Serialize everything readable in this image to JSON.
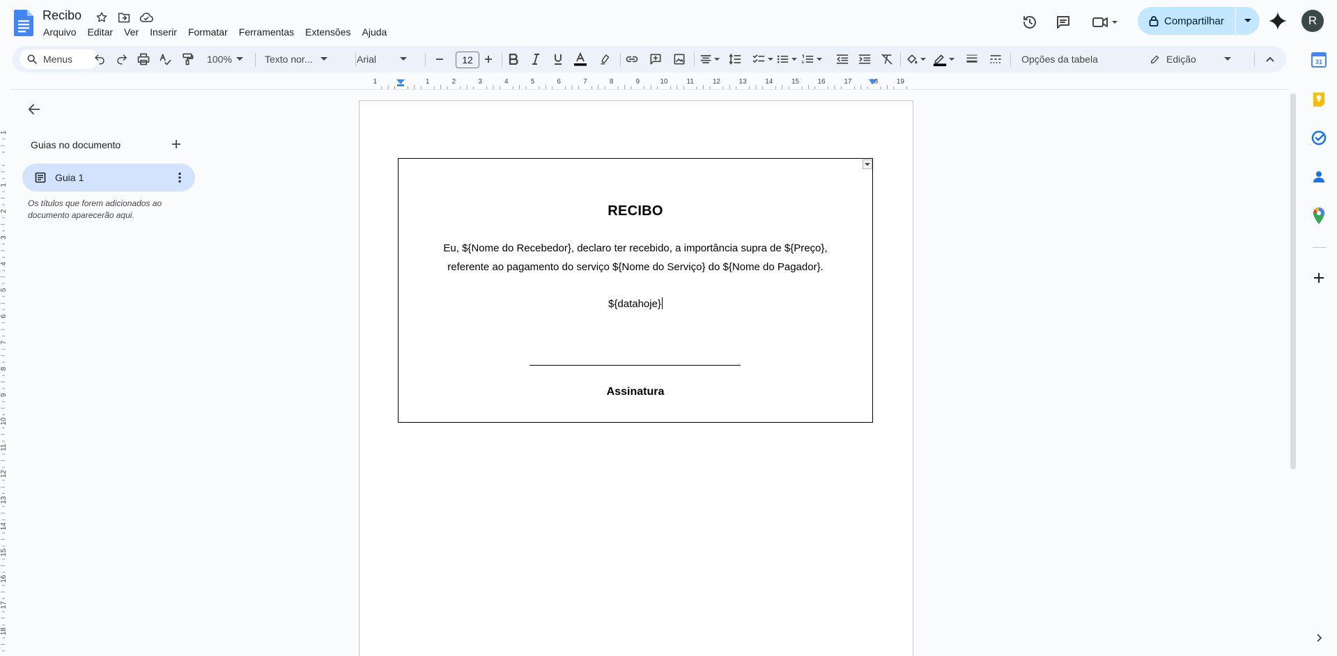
{
  "document": {
    "title": "Recibo"
  },
  "menu": [
    "Arquivo",
    "Editar",
    "Ver",
    "Inserir",
    "Formatar",
    "Ferramentas",
    "Extensões",
    "Ajuda"
  ],
  "share": {
    "label": "Compartilhar"
  },
  "user": {
    "initial": "R"
  },
  "toolbar": {
    "search_label": "Menus",
    "zoom": "100%",
    "style": "Texto nor...",
    "font": "Arial",
    "font_size": "12",
    "table_options": "Opções da tabela",
    "mode": "Edição"
  },
  "ruler": {
    "h_ticks": [
      "1",
      "1",
      "2",
      "3",
      "4",
      "5",
      "6",
      "7",
      "8",
      "9",
      "10",
      "11",
      "12",
      "13",
      "14",
      "15",
      "16",
      "17",
      "18",
      "19"
    ],
    "v_ticks": [
      "1",
      "1",
      "2",
      "3",
      "4",
      "5",
      "6",
      "7",
      "8",
      "9",
      "10",
      "11",
      "12",
      "13",
      "14",
      "15",
      "16",
      "17",
      "18",
      "19"
    ]
  },
  "sidebar": {
    "outline_title": "Guias no documento",
    "tab_label": "Guia 1",
    "hint": "Os títulos que forem adicionados ao documento aparecerão aqui."
  },
  "receipt": {
    "title": "RECIBO",
    "line1": "Eu, ${Nome do Recebedor}, declaro ter recebido, a importância supra de ${Preço},",
    "line2": "referente ao pagamento do serviço ${Nome do Serviço} do ${Nome do Pagador}.",
    "date": "${datahoje}",
    "signature": "Assinatura"
  },
  "side_apps": [
    {
      "icon": "calendar-icon",
      "label": "31"
    },
    {
      "icon": "keep-icon"
    },
    {
      "icon": "tasks-icon"
    },
    {
      "icon": "contacts-icon"
    },
    {
      "icon": "maps-icon"
    }
  ],
  "colors": {
    "accent": "#0b57d0",
    "share_bg": "#c2e7ff",
    "selected_tab": "#d3e3fd",
    "toolbar_bg": "#edf2fa"
  }
}
